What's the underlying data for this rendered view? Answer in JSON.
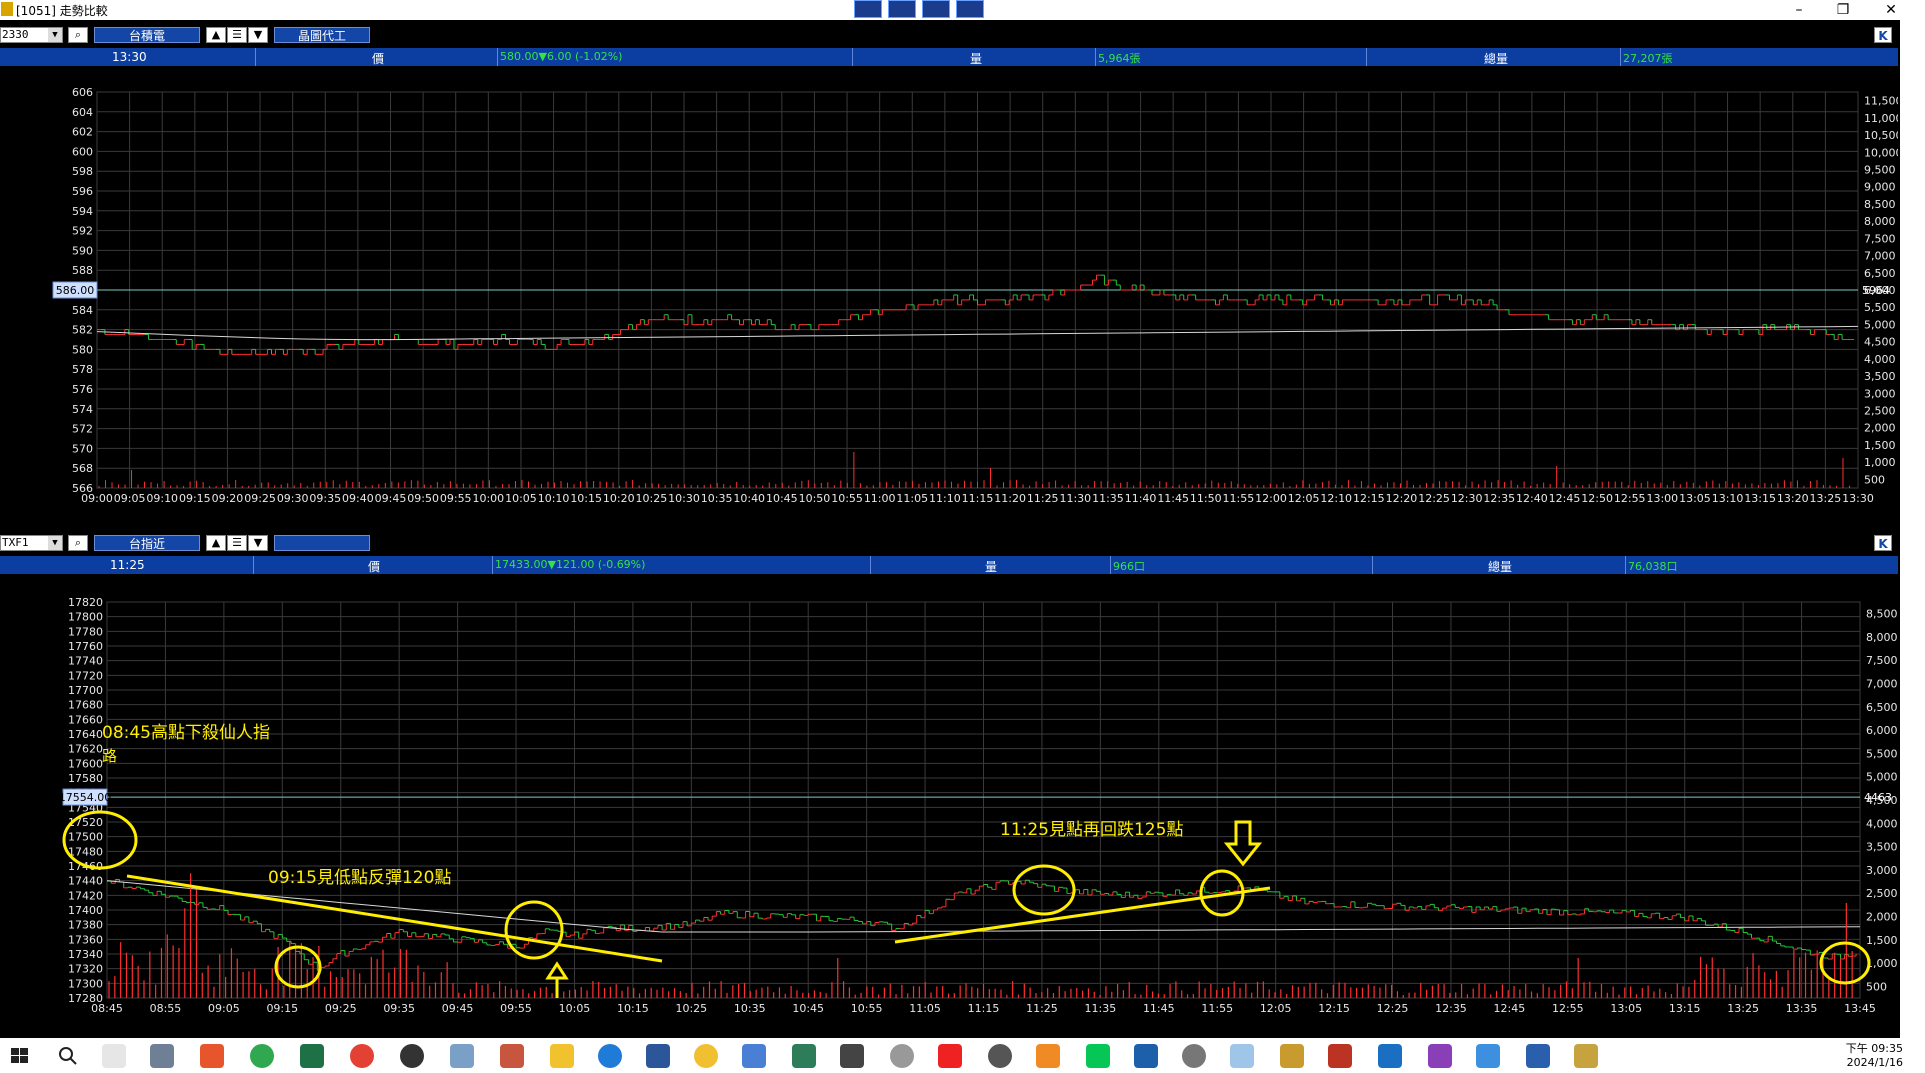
{
  "window": {
    "title": "[1051] 走勢比較",
    "min": "–",
    "restore": "❐",
    "close": "✕"
  },
  "top": {
    "symbol": "2330",
    "name": "台積電",
    "category": "晶圖代工",
    "time": "13:30",
    "price_label": "價",
    "price_value": "580.00▼6.00 (-1.02%)",
    "vol_label": "量",
    "vol_value": "5,964張",
    "total_label": "總量",
    "total_value": "27,207張",
    "price_ticks": [
      "606",
      "604",
      "602",
      "600",
      "598",
      "596",
      "594",
      "592",
      "590",
      "588",
      "586",
      "584",
      "582",
      "580",
      "578",
      "576",
      "574",
      "572",
      "570",
      "568",
      "566"
    ],
    "vol_ticks": [
      "11,500",
      "11,000",
      "10,500",
      "10,000",
      "9,500",
      "9,000",
      "8,500",
      "8,000",
      "7,500",
      "7,000",
      "6,500",
      "6,000",
      "5,500",
      "5,000",
      "4,500",
      "4,000",
      "3,500",
      "3,000",
      "2,500",
      "2,000",
      "1,500",
      "1,000",
      "500"
    ],
    "ref_price": "586.00",
    "ref_vol": "5964",
    "time_ticks": [
      "09:00",
      "09:05",
      "09:10",
      "09:15",
      "09:20",
      "09:25",
      "09:30",
      "09:35",
      "09:40",
      "09:45",
      "09:50",
      "09:55",
      "10:00",
      "10:05",
      "10:10",
      "10:15",
      "10:20",
      "10:25",
      "10:30",
      "10:35",
      "10:40",
      "10:45",
      "10:50",
      "10:55",
      "11:00",
      "11:05",
      "11:10",
      "11:15",
      "11:20",
      "11:25",
      "11:30",
      "11:35",
      "11:40",
      "11:45",
      "11:50",
      "11:55",
      "12:00",
      "12:05",
      "12:10",
      "12:15",
      "12:20",
      "12:25",
      "12:30",
      "12:35",
      "12:40",
      "12:45",
      "12:50",
      "12:55",
      "13:00",
      "13:05",
      "13:10",
      "13:15",
      "13:20",
      "13:25",
      "13:30"
    ]
  },
  "bottom": {
    "symbol": "TXF1",
    "name": "台指近",
    "category": "",
    "time": "11:25",
    "price_label": "價",
    "price_value": "17433.00▼121.00 (-0.69%)",
    "vol_label": "量",
    "vol_value": "966口",
    "total_label": "總量",
    "total_value": "76,038口",
    "price_ticks": [
      "17820",
      "17800",
      "17780",
      "17760",
      "17740",
      "17720",
      "17700",
      "17680",
      "17660",
      "17640",
      "17620",
      "17600",
      "17580",
      "17560",
      "17540",
      "17520",
      "17500",
      "17480",
      "17460",
      "17440",
      "17420",
      "17400",
      "17380",
      "17360",
      "17340",
      "17320",
      "17300",
      "17280"
    ],
    "vol_ticks": [
      "8,500",
      "8,000",
      "7,500",
      "7,000",
      "6,500",
      "6,000",
      "5,500",
      "5,000",
      "4,500",
      "4,000",
      "3,500",
      "3,000",
      "2,500",
      "2,000",
      "1,500",
      "1,000",
      "500"
    ],
    "ref_price": "17554.00",
    "ref_vol": "4463",
    "time_ticks": [
      "08:45",
      "08:55",
      "09:05",
      "09:15",
      "09:25",
      "09:35",
      "09:45",
      "09:55",
      "10:05",
      "10:15",
      "10:25",
      "10:35",
      "10:45",
      "10:55",
      "11:05",
      "11:15",
      "11:25",
      "11:35",
      "11:45",
      "11:55",
      "12:05",
      "12:15",
      "12:25",
      "12:35",
      "12:45",
      "12:55",
      "13:05",
      "13:15",
      "13:25",
      "13:35",
      "13:45"
    ],
    "annotations": {
      "a1": "08:45高點下殺仙人指",
      "a1b": "路",
      "a2": "09:15見低點反彈120點",
      "a3": "11:25見點再回跌125點"
    }
  },
  "taskbar": {
    "time": "下午 09:35",
    "date": "2024/1/16"
  },
  "colors": {
    "up": "#ff3030",
    "down": "#22c83a",
    "annot": "#ffee00",
    "grid": "#3a3a3a",
    "avg": "#d8d8d8"
  }
}
